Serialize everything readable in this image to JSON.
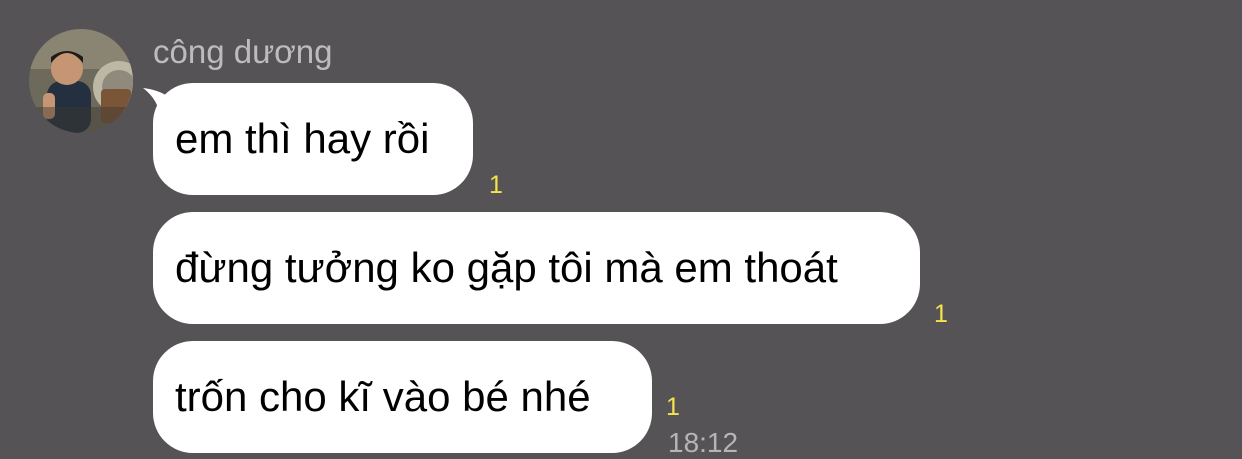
{
  "sender": {
    "name": "công dương"
  },
  "messages": [
    {
      "text": "em thì hay rồi",
      "unread_count": "1"
    },
    {
      "text": "đừng tưởng ko gặp tôi mà em thoát",
      "unread_count": "1"
    },
    {
      "text": "trốn cho kĩ vào bé nhé",
      "unread_count": "1",
      "time": "18:12"
    }
  ],
  "colors": {
    "background": "#555355",
    "bubble": "#ffffff",
    "unread": "#f4e34a",
    "name": "#bdbcbd",
    "time": "#b6b5b6"
  }
}
